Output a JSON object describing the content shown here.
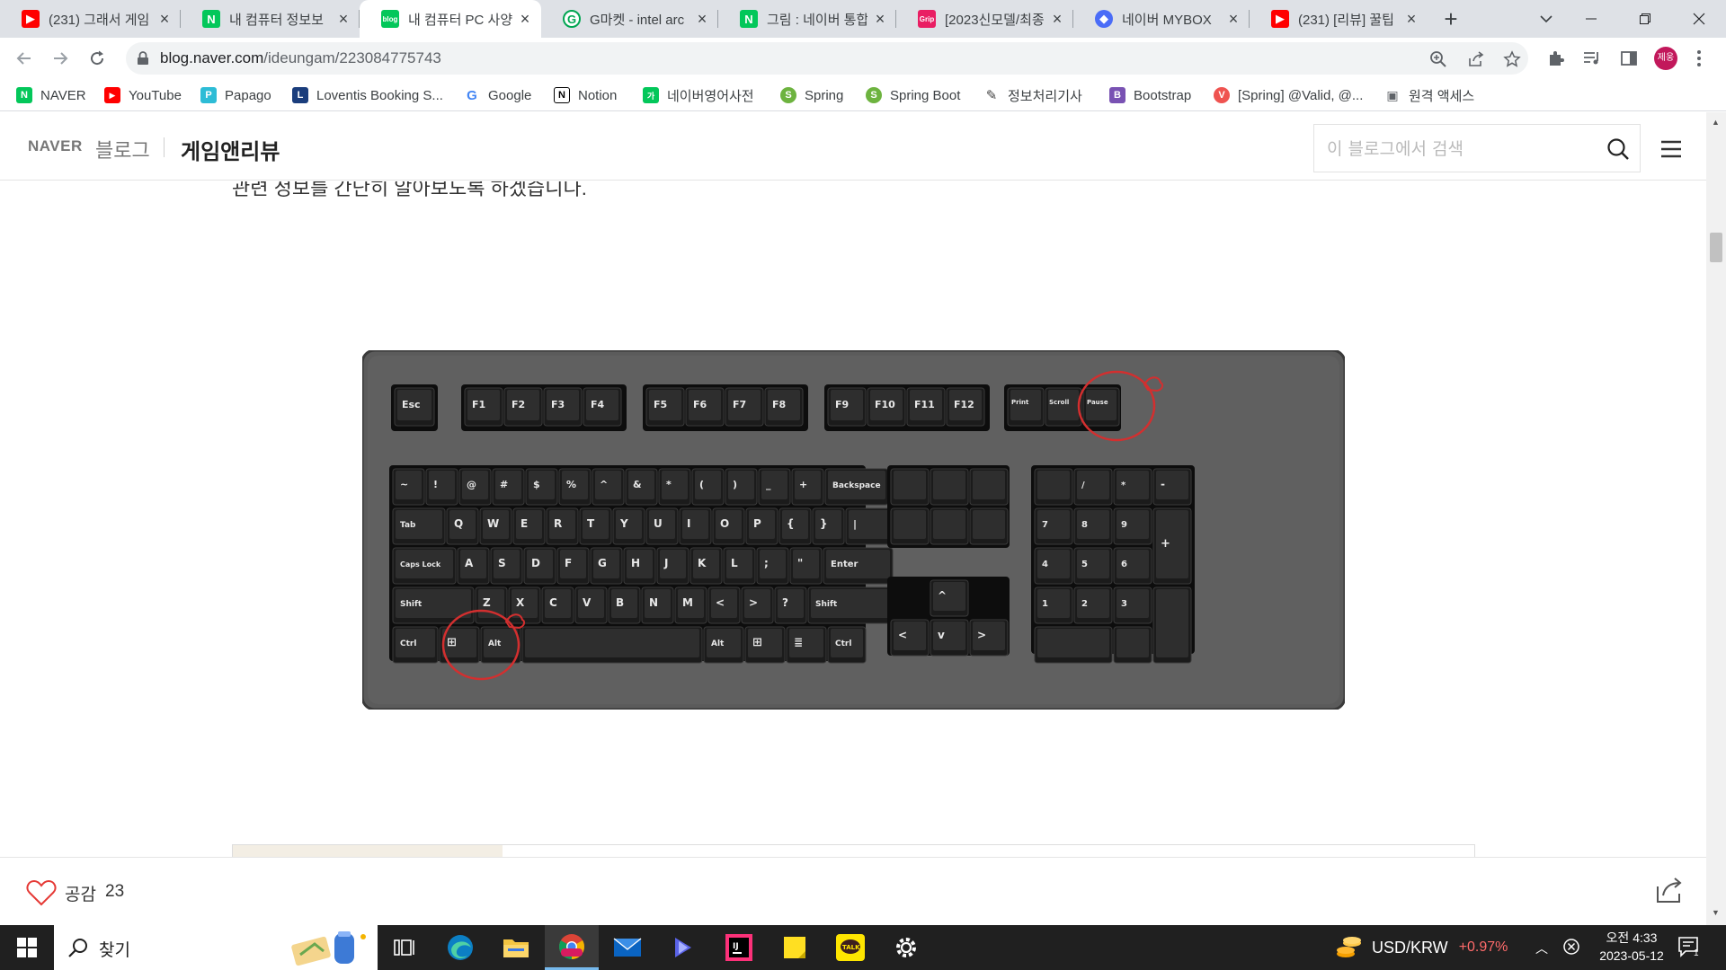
{
  "browser": {
    "tabs": [
      {
        "title": "(231) 그래서 게임",
        "icon": "youtube-icon",
        "color": "#ff0000"
      },
      {
        "title": "내 컴퓨터 정보보",
        "icon": "naver-icon",
        "color": "#03c75a"
      },
      {
        "title": "내 컴퓨터 PC 사양",
        "icon": "naver-blog-icon",
        "color": "#03c75a",
        "active": true
      },
      {
        "title": "G마켓 - intel arc",
        "icon": "gmarket-icon",
        "color": "#00a651"
      },
      {
        "title": "그림 : 네이버 통합",
        "icon": "naver-icon",
        "color": "#03c75a"
      },
      {
        "title": "[2023신모델/최종",
        "icon": "danawa-icon",
        "color": "#e91e63"
      },
      {
        "title": "네이버 MYBOX",
        "icon": "mybox-icon",
        "color": "#4a6cf7"
      },
      {
        "title": "(231) [리뷰] 꿀팁",
        "icon": "youtube-icon",
        "color": "#ff0000"
      }
    ],
    "new_tab": "+",
    "url_host": "blog.naver.com",
    "url_path": "/ideungam/223084775743",
    "profile_initials": "제웅",
    "bookmarks": [
      {
        "label": "NAVER",
        "icon": "naver-icon",
        "color": "#03c75a",
        "glyph": "N"
      },
      {
        "label": "YouTube",
        "icon": "youtube-icon",
        "color": "#ff0000",
        "glyph": "▶"
      },
      {
        "label": "Papago",
        "icon": "papago-icon",
        "color": "#2dbcd6",
        "glyph": "P"
      },
      {
        "label": "Loventis Booking S...",
        "icon": "loventis-icon",
        "color": "#1a3d7c",
        "glyph": "L"
      },
      {
        "label": "Google",
        "icon": "google-icon",
        "color": "#4285f4",
        "glyph": "G"
      },
      {
        "label": "Notion",
        "icon": "notion-icon",
        "color": "#000000",
        "glyph": "N"
      },
      {
        "label": "네이버영어사전",
        "icon": "naver-dict-icon",
        "color": "#03c75a",
        "glyph": "가"
      },
      {
        "label": "Spring",
        "icon": "spring-icon",
        "color": "#6db33f",
        "glyph": "S"
      },
      {
        "label": "Spring Boot",
        "icon": "spring-icon",
        "color": "#6db33f",
        "glyph": "S"
      },
      {
        "label": "정보처리기사",
        "icon": "pen-icon",
        "color": "#444444",
        "glyph": "✎"
      },
      {
        "label": "Bootstrap",
        "icon": "bootstrap-icon",
        "color": "#7952b3",
        "glyph": "B"
      },
      {
        "label": "[Spring] @Valid, @...",
        "icon": "velog-icon",
        "color": "#ef5350",
        "glyph": "V"
      },
      {
        "label": "원격 액세스",
        "icon": "remote-access-icon",
        "color": "#5f6368",
        "glyph": "▣"
      }
    ]
  },
  "blog": {
    "naver_logo": "NAVER",
    "blog_word": "블로그",
    "blog_name": "게임앤리뷰",
    "search_placeholder": "이 블로그에서 검색",
    "clipped_text": "관련 정보를 간단히 알아보도록 하겠습니다.",
    "like_label": "공감",
    "like_count": "23",
    "keyboard": {
      "fn_row": [
        "Esc",
        "F1",
        "F2",
        "F3",
        "F4",
        "F5",
        "F6",
        "F7",
        "F8",
        "F9",
        "F10",
        "F11",
        "F12"
      ],
      "nav_row": [
        "Print Scr SysRq",
        "Scroll Lock",
        "Pause Break"
      ],
      "highlighted_keys": [
        "Pause Break",
        "Windows"
      ]
    }
  },
  "taskbar": {
    "search_label": "찾기",
    "apps": [
      "task-view-icon",
      "edge-icon",
      "file-explorer-icon",
      "chrome-icon",
      "mail-icon",
      "copilot-icon",
      "intellij-icon",
      "sticky-notes-icon",
      "kakaotalk-icon",
      "settings-icon"
    ],
    "currency_pair": "USD/KRW",
    "currency_change": "+0.97%",
    "clock_time": "오전 4:33",
    "clock_date": "2023-05-12",
    "notification_count": "1"
  },
  "colors": {
    "chrome_frame": "#dee1e6",
    "naver_green": "#03c75a",
    "taskbar": "#202020",
    "annotation_red": "#d32f2f"
  }
}
